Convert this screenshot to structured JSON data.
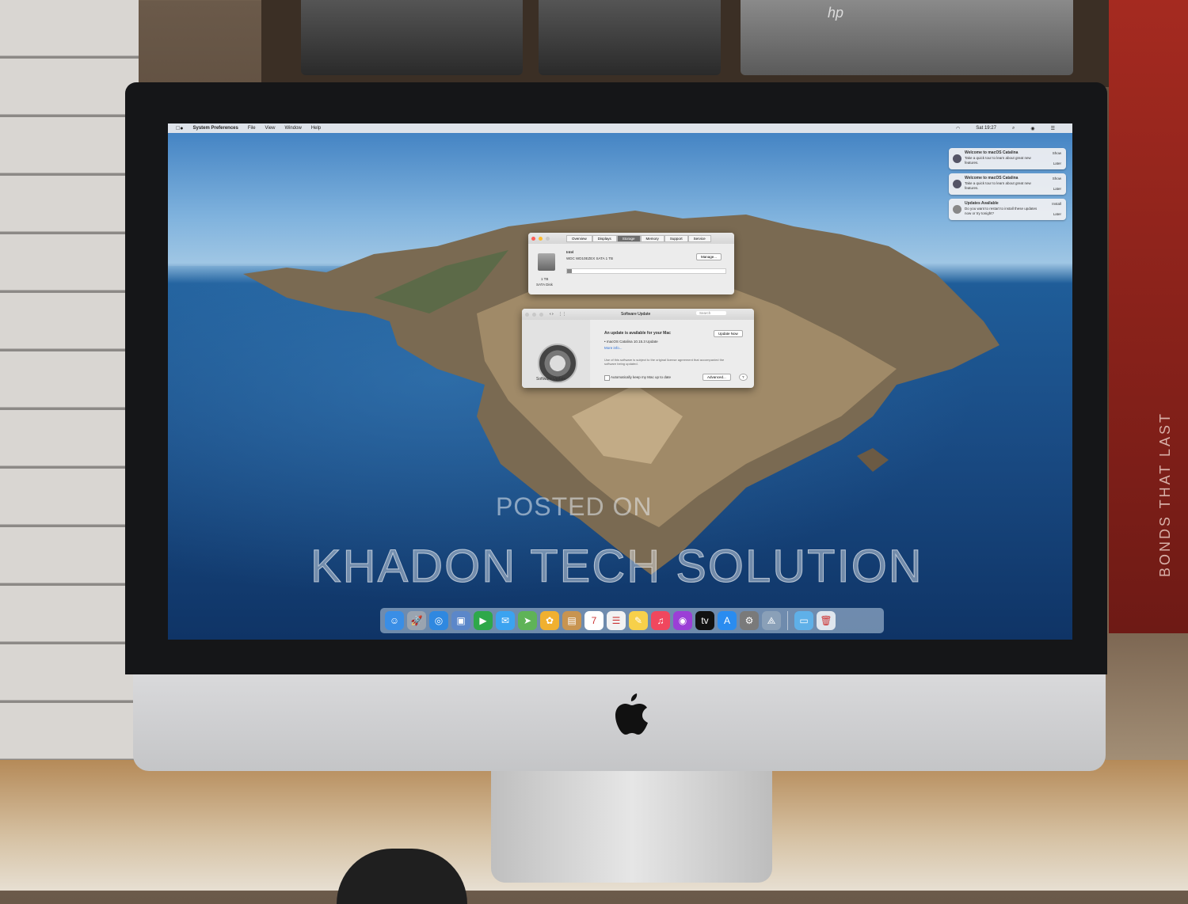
{
  "scene": {
    "store_banner_text": "BONDS THAT LAST",
    "laptop_brand": "hp",
    "watermark_line1": "POSTED ON",
    "watermark_line2": "KHADON TECH SOLUTION"
  },
  "menubar": {
    "apple": "",
    "app_name": "System Preferences",
    "items": [
      "File",
      "View",
      "Window",
      "Help"
    ],
    "clock": "Sat 19:27"
  },
  "notifications": [
    {
      "title": "Welcome to macOS Catalina",
      "body": "Take a quick tour to learn about great new features.",
      "action1": "Show",
      "action2": "Later"
    },
    {
      "title": "Welcome to macOS Catalina",
      "body": "Take a quick tour to learn about great new features.",
      "action1": "Show",
      "action2": "Later"
    },
    {
      "title": "Updates Available",
      "body": "Do you want to restart to install these updates now or try tonight?",
      "action1": "Install",
      "action2": "Later"
    }
  ],
  "about_window": {
    "tabs": [
      "Overview",
      "Displays",
      "Storage",
      "Memory",
      "Support",
      "Service"
    ],
    "active_tab": "Storage",
    "disk_name": "Intel",
    "disk_detail": "WDC WD10EZEX SATA 1 TB",
    "manage_button": "Manage...",
    "disk_label_1": "1 TB",
    "disk_label_2": "SATA Disk",
    "used_fraction": 0.03
  },
  "software_update": {
    "title": "Software Update",
    "search_placeholder": "Search",
    "icon_label": "Software Update",
    "headline": "An update is available for your Mac",
    "update_name": "• macOS Catalina 10.15.3 Update",
    "more_info": "More info...",
    "license_text": "Use of this software is subject to the original license agreement that accompanied the software being updated.",
    "update_now_button": "Update Now",
    "auto_checkbox": "Automatically keep my Mac up to date",
    "advanced_button": "Advanced...",
    "help_button": "?"
  },
  "dock": {
    "items": [
      {
        "name": "finder-icon",
        "color": "#3a8ee6",
        "glyph": "☺"
      },
      {
        "name": "launchpad-icon",
        "color": "#9aa4b0",
        "glyph": "🚀"
      },
      {
        "name": "safari-icon",
        "color": "#2f88e0",
        "glyph": "◎"
      },
      {
        "name": "preview-icon",
        "color": "#5b87c9",
        "glyph": "▣"
      },
      {
        "name": "facetime-icon",
        "color": "#2ea84a",
        "glyph": "▶"
      },
      {
        "name": "messages-icon",
        "color": "#3ba3f0",
        "glyph": "✉"
      },
      {
        "name": "maps-icon",
        "color": "#5fb357",
        "glyph": "➤"
      },
      {
        "name": "photos-icon",
        "color": "#f0b030",
        "glyph": "✿"
      },
      {
        "name": "contacts-icon",
        "color": "#c89450",
        "glyph": "▤"
      },
      {
        "name": "calendar-icon",
        "color": "#ffffff",
        "glyph": "7"
      },
      {
        "name": "reminders-icon",
        "color": "#f2f2f2",
        "glyph": "☰"
      },
      {
        "name": "notes-icon",
        "color": "#f7d04a",
        "glyph": "✎"
      },
      {
        "name": "music-icon",
        "color": "#f0475e",
        "glyph": "♫"
      },
      {
        "name": "podcasts-icon",
        "color": "#9b3fd6",
        "glyph": "◉"
      },
      {
        "name": "tv-icon",
        "color": "#111111",
        "glyph": "tv"
      },
      {
        "name": "app-store-icon",
        "color": "#2a8cf0",
        "glyph": "A"
      },
      {
        "name": "system-preferences-icon",
        "color": "#7a7a7a",
        "glyph": "⚙"
      },
      {
        "name": "utility-icon",
        "color": "#8aa0b8",
        "glyph": "⟁"
      },
      {
        "name": "downloads-folder-icon",
        "color": "#5fb0e8",
        "glyph": "▭"
      },
      {
        "name": "trash-icon",
        "color": "#dfe6ee",
        "glyph": "🗑"
      }
    ]
  }
}
